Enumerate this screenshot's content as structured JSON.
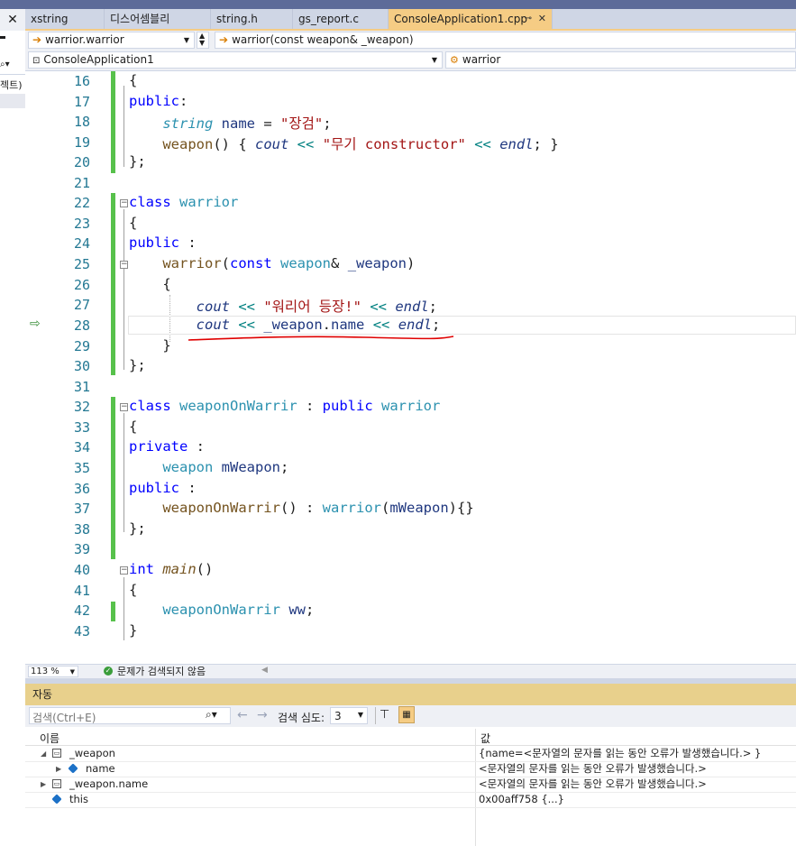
{
  "tabs": [
    {
      "label": "xstring"
    },
    {
      "label": "디스어셈블리"
    },
    {
      "label": "string.h"
    },
    {
      "label": "gs_report.c"
    },
    {
      "label": "ConsoleApplication1.cpp",
      "active": true
    }
  ],
  "left_panel": {
    "text": "젝트)"
  },
  "nav": {
    "scope_dropdown": "warrior.warrior",
    "member_dropdown": "warrior(const weapon& _weapon)",
    "project_dropdown": "ConsoleApplication1",
    "class_dropdown": "warrior"
  },
  "code_lines": [
    {
      "num": "16",
      "text": "{"
    },
    {
      "num": "17",
      "text": "public:"
    },
    {
      "num": "18",
      "text": "    string name = \"장검\";"
    },
    {
      "num": "19",
      "text": "    weapon() { cout << \"무기 constructor\" << endl; }"
    },
    {
      "num": "20",
      "text": "};"
    },
    {
      "num": "21",
      "text": ""
    },
    {
      "num": "22",
      "text": "class warrior"
    },
    {
      "num": "23",
      "text": "{"
    },
    {
      "num": "24",
      "text": "public :"
    },
    {
      "num": "25",
      "text": "    warrior(const weapon& _weapon)"
    },
    {
      "num": "26",
      "text": "    {"
    },
    {
      "num": "27",
      "text": "        cout << \"워리어 등장!\" << endl;"
    },
    {
      "num": "28",
      "text": "        cout << _weapon.name << endl;"
    },
    {
      "num": "29",
      "text": "    }"
    },
    {
      "num": "30",
      "text": "};"
    },
    {
      "num": "31",
      "text": ""
    },
    {
      "num": "32",
      "text": "class weaponOnWarrir : public warrior"
    },
    {
      "num": "33",
      "text": "{"
    },
    {
      "num": "34",
      "text": "private :"
    },
    {
      "num": "35",
      "text": "    weapon mWeapon;"
    },
    {
      "num": "36",
      "text": "public :"
    },
    {
      "num": "37",
      "text": "    weaponOnWarrir() : warrior(mWeapon){}"
    },
    {
      "num": "38",
      "text": "};"
    },
    {
      "num": "39",
      "text": ""
    },
    {
      "num": "40",
      "text": "int main()"
    },
    {
      "num": "41",
      "text": "{"
    },
    {
      "num": "42",
      "text": "    weaponOnWarrir ww;"
    },
    {
      "num": "43",
      "text": "}"
    }
  ],
  "status": {
    "zoom": "113 %",
    "issues": "문제가 검색되지 않음"
  },
  "autos": {
    "title": "자동",
    "search_placeholder": "검색(Ctrl+E)",
    "search_depth_label": "검색 심도:",
    "search_depth_value": "3",
    "col_name": "이름",
    "col_value": "값",
    "rows": [
      {
        "name": "_weapon",
        "value": "{name=<문자열의 문자를 읽는 동안 오류가 발생했습니다.> }",
        "expanded": true
      },
      {
        "name": "name",
        "value": "<문자열의 문자를 읽는 동안 오류가 발생했습니다.>"
      },
      {
        "name": "_weapon.name",
        "value": "<문자열의 문자를 읽는 동안 오류가 발생했습니다.>"
      },
      {
        "name": "this",
        "value": "0x00aff758 {...}"
      }
    ]
  },
  "colors": {
    "active_tab": "#f5cc84",
    "keyword": "#0000ff",
    "type": "#2b91af",
    "string": "#a31515",
    "change_bar": "#57c14b",
    "squiggle": "#e00000"
  }
}
